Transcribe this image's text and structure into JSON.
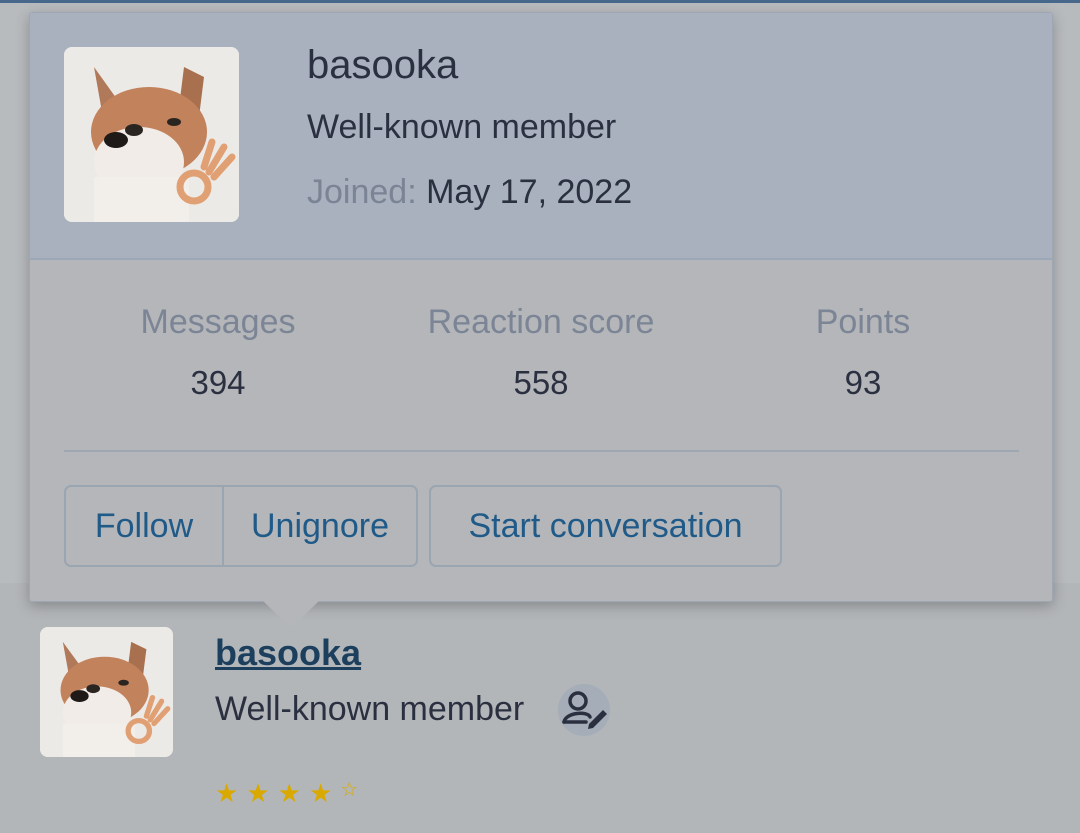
{
  "popup": {
    "username": "basooka",
    "user_title": "Well-known member",
    "joined_label": "Joined:",
    "joined_value": "May 17, 2022",
    "stats": [
      {
        "label": "Messages",
        "value": "394"
      },
      {
        "label": "Reaction score",
        "value": "558"
      },
      {
        "label": "Points",
        "value": "93"
      }
    ],
    "buttons": {
      "follow": "Follow",
      "unignore": "Unignore",
      "start_conversation": "Start conversation"
    }
  },
  "author": {
    "username": "basooka",
    "user_title": "Well-known member",
    "rating": {
      "stars": 4.5,
      "max": 5
    }
  },
  "icons": {
    "avatar": "shiba-dog-avatar",
    "edit": "user-edit-icon",
    "star": "star-icon"
  },
  "colors": {
    "link": "#1f5a88",
    "username_link": "#1d3f5e",
    "star": "#d9a900",
    "header_bg": "#a8b1bd"
  }
}
